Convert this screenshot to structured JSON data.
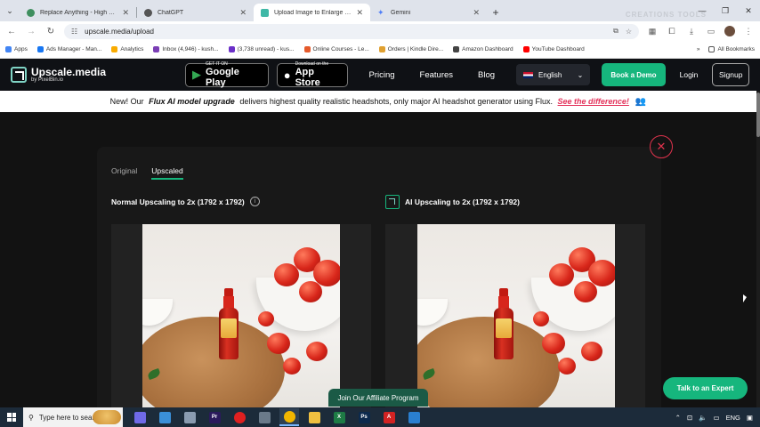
{
  "browser": {
    "tabs": [
      {
        "title": "Replace Anything - High Quali",
        "color": "#3f8f5f",
        "active": false
      },
      {
        "title": "ChatGPT",
        "color": "#555555",
        "active": false
      },
      {
        "title": "Upload Image to Enlarge & En",
        "color": "#3fb8a6",
        "active": true
      },
      {
        "title": "Gemini",
        "color": "#4f7ef7",
        "active": false
      }
    ],
    "watermark": "CREATIONS TOOLS",
    "url": "upscale.media/upload",
    "bookmarks": [
      {
        "label": "Apps",
        "color": "#4285f4"
      },
      {
        "label": "Ads Manager - Man...",
        "color": "#1877f2"
      },
      {
        "label": "Analytics",
        "color": "#f9ab00"
      },
      {
        "label": "Inbox (4,946) - kush...",
        "color": "#7b3fb5"
      },
      {
        "label": "(3,738 unread) - kus...",
        "color": "#6b30c8"
      },
      {
        "label": "Online Courses - Le...",
        "color": "#e55a2b"
      },
      {
        "label": "Orders | Kindle Dire...",
        "color": "#e0a030"
      },
      {
        "label": "Amazon Dashboard",
        "color": "#444444"
      },
      {
        "label": "YouTube Dashboard",
        "color": "#ff0000"
      }
    ],
    "all_bookmarks": "All Bookmarks"
  },
  "site": {
    "logo_name": "Upscale.media",
    "logo_sub": "by PixelBin.io",
    "google_play": {
      "small": "GET IT ON",
      "big": "Google Play"
    },
    "app_store": {
      "small": "Download on the",
      "big": "App Store"
    },
    "nav": [
      "Pricing",
      "Features",
      "Blog"
    ],
    "language": "English",
    "demo_button": "Book a Demo",
    "login": "Login",
    "signup": "Signup",
    "accent": "#16b67d"
  },
  "announcement": {
    "prefix": "New! Our ",
    "highlight": "Flux AI model upgrade",
    "middle": " delivers highest quality realistic headshots, only major AI headshot generator using Flux. ",
    "link": "See the difference!"
  },
  "result": {
    "tab_original": "Original",
    "tab_upscaled": "Upscaled",
    "active_tab": "Upscaled",
    "normal_title": "Normal Upscaling to 2x (1792 x 1792)",
    "ai_title": "AI Upscaling to 2x (1792 x 1792)"
  },
  "floating": {
    "affiliate": "Join Our Affiliate Program",
    "expert": "Talk to an Expert"
  },
  "taskbar": {
    "search_placeholder": "Type here to search",
    "apps": [
      {
        "name": "copilot",
        "color": "#6f6ae8",
        "text": ""
      },
      {
        "name": "files",
        "color": "#3a8fd8",
        "text": ""
      },
      {
        "name": "settings",
        "color": "#8a9bb0",
        "text": ""
      },
      {
        "name": "premiere",
        "color": "#2b1a5c",
        "text": "Pr"
      },
      {
        "name": "record",
        "color": "#e02020",
        "text": ""
      },
      {
        "name": "photos",
        "color": "#6a7a8a",
        "text": ""
      },
      {
        "name": "chrome",
        "color": "#f2b600",
        "text": ""
      },
      {
        "name": "explorer",
        "color": "#f0c040",
        "text": ""
      },
      {
        "name": "excel",
        "color": "#1e7b45",
        "text": "X"
      },
      {
        "name": "photoshop",
        "color": "#0c2a4d",
        "text": "Ps"
      },
      {
        "name": "acrobat",
        "color": "#d22323",
        "text": "A"
      },
      {
        "name": "paint",
        "color": "#2a7fd0",
        "text": ""
      }
    ],
    "lang": "ENG"
  }
}
